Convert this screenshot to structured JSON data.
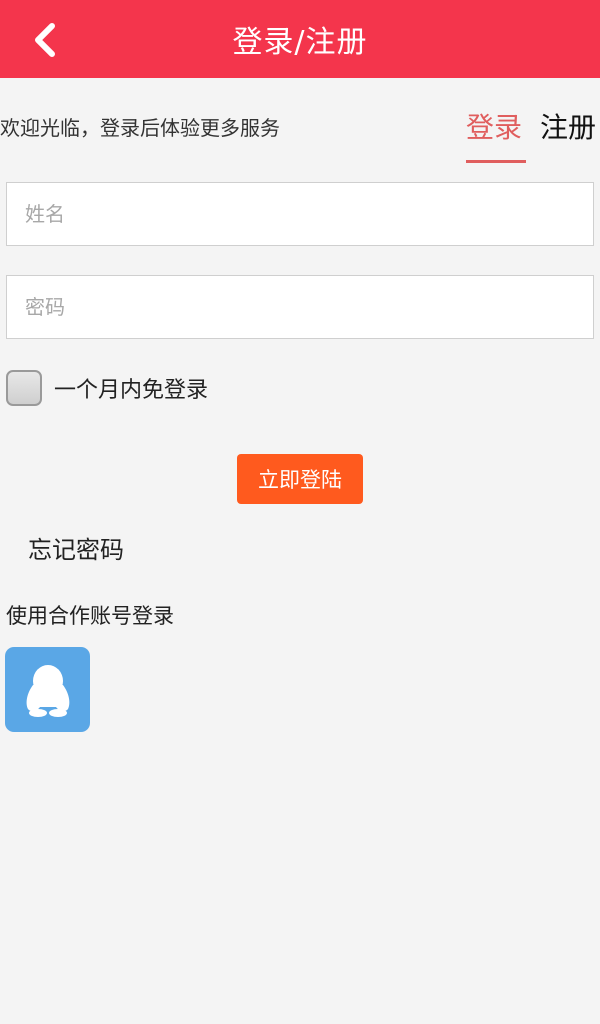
{
  "header": {
    "title": "登录/注册",
    "back_icon": "chevron-left-icon",
    "background": "#f4354c"
  },
  "welcome_text": "欢迎光临，登录后体验更多服务",
  "tabs": [
    {
      "label": "登录",
      "active": true,
      "color": "#e05e5e"
    },
    {
      "label": "注册",
      "active": false
    }
  ],
  "form": {
    "name_placeholder": "姓名",
    "password_placeholder": "密码",
    "remember_label": "一个月内免登录",
    "remember_checked": false,
    "submit_label": "立即登陆",
    "submit_color": "#ff5a1e"
  },
  "forgot_password_label": "忘记密码",
  "partner_login": {
    "label": "使用合作账号登录",
    "providers": [
      {
        "icon": "qq-penguin-icon",
        "color": "#5aa7e6"
      }
    ]
  }
}
